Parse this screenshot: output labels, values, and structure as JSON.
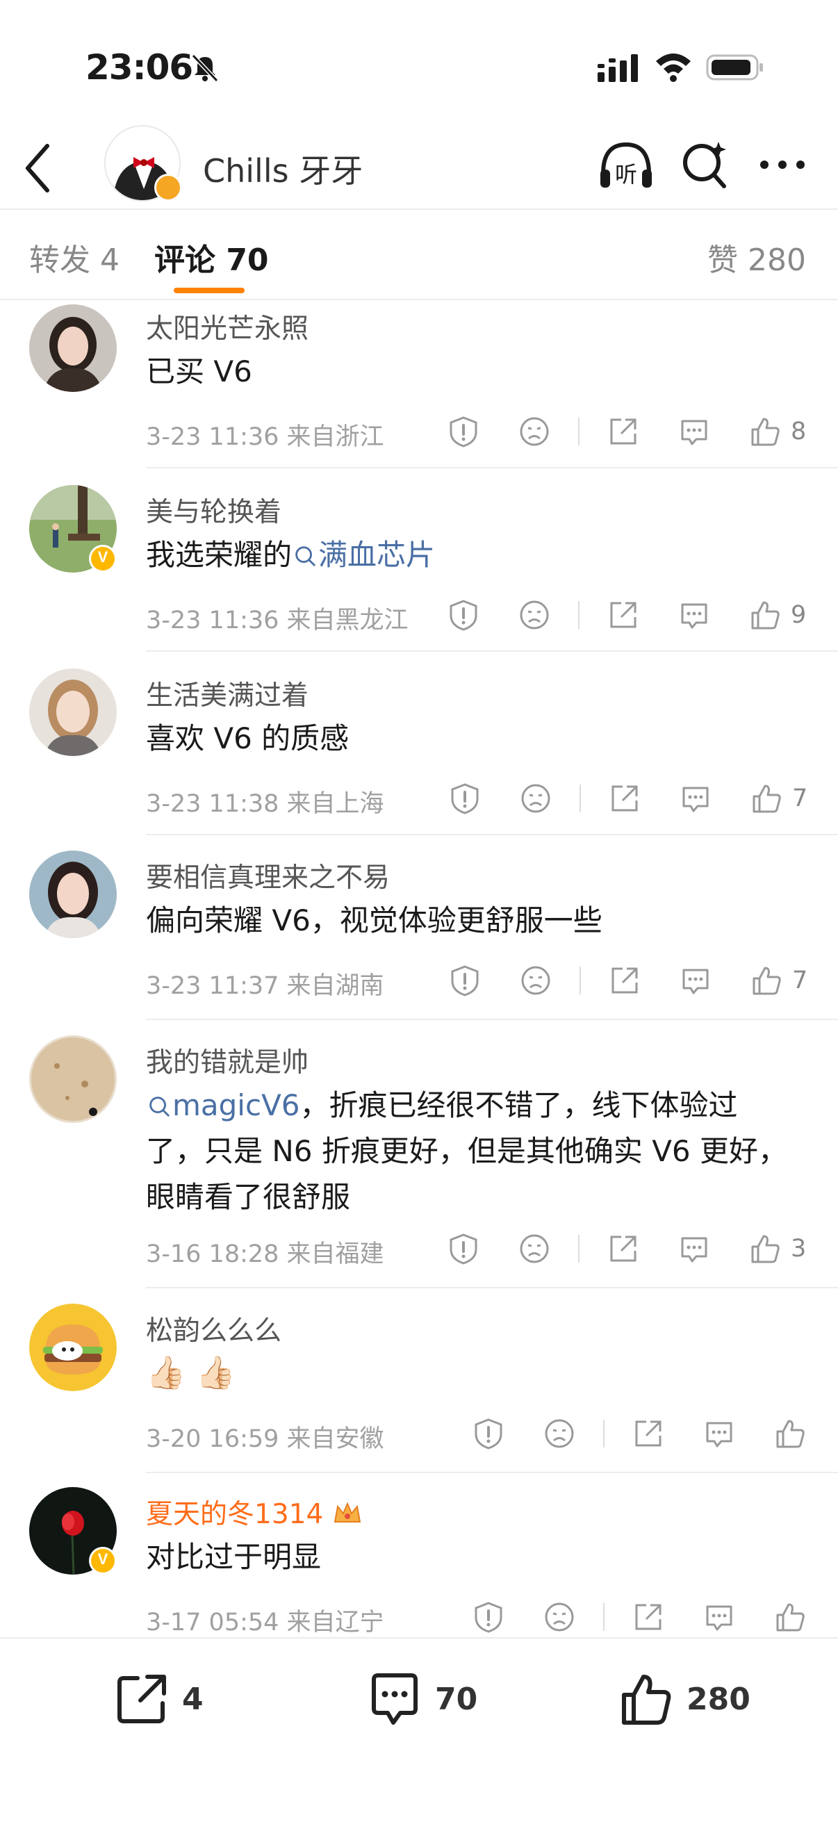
{
  "status_bar": {
    "time": "23:06"
  },
  "nav": {
    "title": "Chills 牙牙",
    "listen_label": "听"
  },
  "tabs": {
    "forward": "转发 4",
    "comments": "评论 70",
    "likes": "赞 280"
  },
  "comments": [
    {
      "name": "太阳光芒永照",
      "text": "已买 V6",
      "meta": "3-23 11:36 来自浙江",
      "likes": "8"
    },
    {
      "name": "美与轮换着",
      "text_prefix": "我选荣耀的",
      "topic": "满血芯片",
      "meta": "3-23 11:36 来自黑龙江",
      "likes": "9"
    },
    {
      "name": "生活美满过着",
      "text": "喜欢 V6 的质感",
      "meta": "3-23 11:38 来自上海",
      "likes": "7"
    },
    {
      "name": "要相信真理来之不易",
      "text": "偏向荣耀 V6，视觉体验更舒服一些",
      "meta": "3-23 11:37 来自湖南",
      "likes": "7"
    },
    {
      "name": "我的错就是帅",
      "topic": "magicV6",
      "line1_rest": "，折痕已经很不错了，线下体验过",
      "line2": "了，只是 N6 折痕更好，但是其他确实 V6 更好，",
      "line3": "眼睛看了很舒服",
      "meta": "3-16 18:28 来自福建",
      "likes": "3"
    },
    {
      "name": "松韵么么么",
      "text": "👍🏻 👍🏻",
      "meta": "3-20 16:59 来自安徽",
      "likes": ""
    },
    {
      "name": "夏天的冬1314",
      "text": "对比过于明显",
      "meta": "3-17 05:54 来自辽宁",
      "likes": ""
    }
  ],
  "bottom_bar": {
    "forward_count": "4",
    "comment_count": "70",
    "like_count": "280"
  },
  "colors": {
    "accent": "#ff8200",
    "topic": "#4a6fa5",
    "vip_name": "#ff6d1b"
  }
}
